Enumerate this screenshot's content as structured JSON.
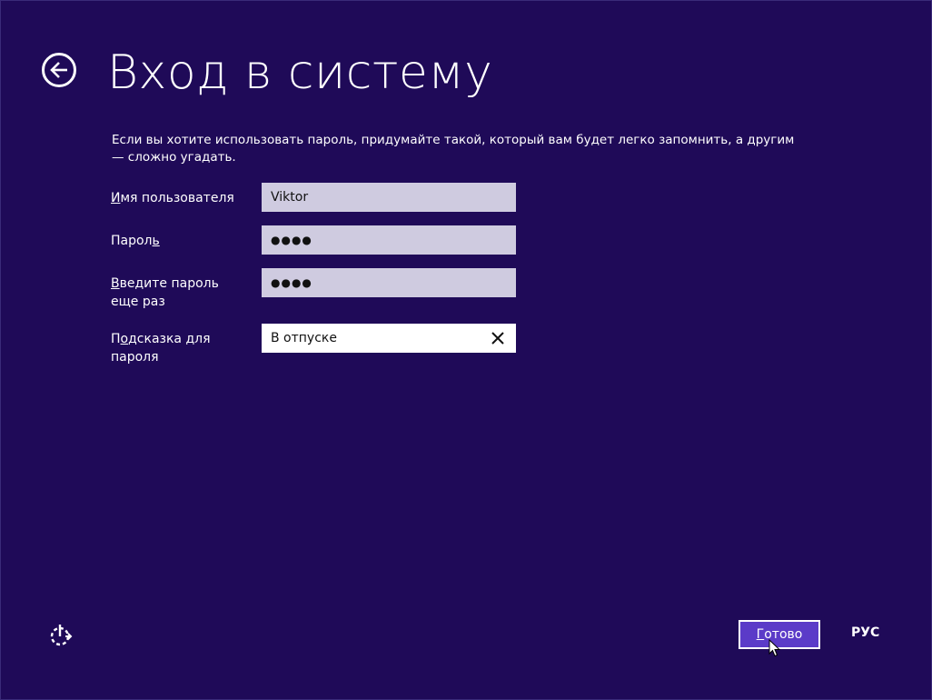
{
  "header": {
    "title": "Вход в систему"
  },
  "intro": {
    "text": "Если вы хотите использовать пароль, придумайте такой, который вам будет легко запомнить, а другим — сложно угадать."
  },
  "form": {
    "username": {
      "label_underlined": "И",
      "label_rest": "мя пользователя",
      "value": "Viktor"
    },
    "password": {
      "label_start": "Парол",
      "label_underlined": "ь",
      "value": "●●●●"
    },
    "password_confirm": {
      "label_underlined": "В",
      "label_rest": "ведите пароль еще раз",
      "value": "●●●●"
    },
    "hint": {
      "label_start": "П",
      "label_underlined": "о",
      "label_rest": "дсказка для пароля",
      "value": "В отпуске"
    }
  },
  "footer": {
    "done_underlined": "Г",
    "done_rest": "отово",
    "language": "РУС"
  },
  "icons": {
    "back": "back-arrow-icon",
    "clear": "close-icon",
    "ease_of_access": "ease-of-access-icon"
  },
  "colors": {
    "background": "#1f0a58",
    "field": "#cfcbe0",
    "accent_button": "#5b3bc8"
  }
}
